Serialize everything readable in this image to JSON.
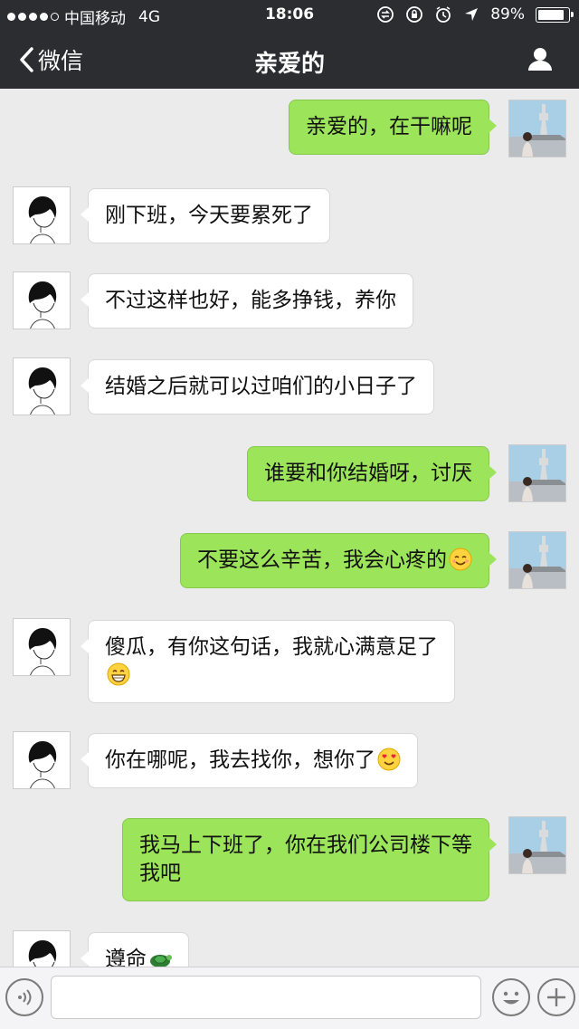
{
  "status_bar": {
    "carrier": "中国移动",
    "network": "4G",
    "time": "18:06",
    "battery_text": "89%",
    "battery_level": 0.89
  },
  "nav": {
    "back_label": "微信",
    "title": "亲爱的"
  },
  "messages": [
    {
      "side": "out",
      "text": "亲爱的，在干嘛呢"
    },
    {
      "side": "in",
      "text": "刚下班，今天要累死了"
    },
    {
      "side": "in",
      "text": "不过这样也好，能多挣钱，养你"
    },
    {
      "side": "in",
      "text": "结婚之后就可以过咱们的小日子了"
    },
    {
      "side": "out",
      "text": "谁要和你结婚呀，讨厌"
    },
    {
      "side": "out",
      "text": "不要这么辛苦，我会心疼的",
      "emoji": "smile-emoji"
    },
    {
      "side": "in",
      "text": "傻瓜，有你这句话，我就心满意足了",
      "emoji": "grin-emoji"
    },
    {
      "side": "in",
      "text": "你在哪呢，我去找你，想你了",
      "emoji": "heart-eyes-emoji"
    },
    {
      "side": "out",
      "text": "我马上下班了，你在我们公司楼下等我吧"
    },
    {
      "side": "in",
      "text": "遵命",
      "emoji": "turtle-emoji"
    }
  ],
  "input": {
    "value": "",
    "placeholder": ""
  },
  "colors": {
    "nav_bg": "#2b2d31",
    "chat_bg": "#ebebeb",
    "outgoing_bubble": "#9ce45a",
    "incoming_bubble": "#ffffff"
  },
  "icons": {
    "back": "chevron-left-icon",
    "profile": "person-icon",
    "voice": "voice-icon",
    "emoji": "emoji-face-icon",
    "more": "plus-icon"
  }
}
